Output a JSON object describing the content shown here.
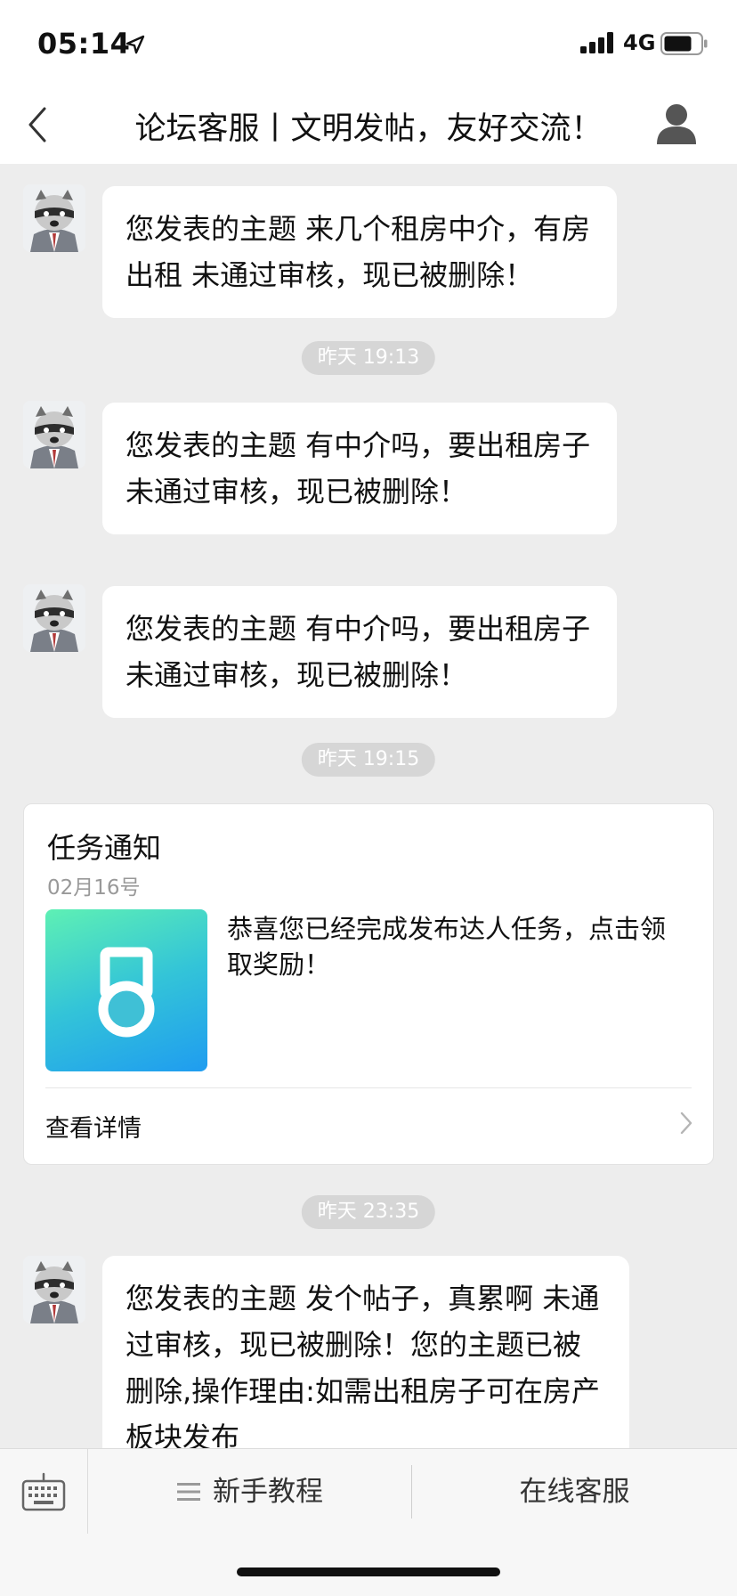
{
  "status_bar": {
    "time": "05:14",
    "network": "4G",
    "icons": [
      "location-arrow-icon",
      "signal-icon",
      "battery-icon"
    ]
  },
  "nav": {
    "title": "论坛客服丨文明发帖，友好交流！",
    "icons": [
      "back-icon",
      "user-icon"
    ]
  },
  "messages": [
    {
      "text": "您发表的主题 来几个租房中介，有房出租 未通过审核，现已被删除！"
    },
    {
      "timestamp": "昨天 19:13"
    },
    {
      "text": "您发表的主题 有中介吗，要出租房子 未通过审核，现已被删除！"
    },
    {
      "text": "您发表的主题 有中介吗，要出租房子 未通过审核，现已被删除！"
    },
    {
      "timestamp": "昨天 19:15"
    },
    {
      "timestamp": "昨天 23:35"
    },
    {
      "text": "您发表的主题 发个帖子，真累啊 未通过审核，现已被删除！您的主题已被删除,操作理由:如需出租房子可在房产板块发布"
    }
  ],
  "card": {
    "title": "任务通知",
    "date": "02月16号",
    "text": "恭喜您已经完成发布达人任务，点击领取奖励！",
    "link_label": "查看详情",
    "icon": "medal-icon"
  },
  "bottom_bar": {
    "guide_label": "新手教程",
    "service_label": "在线客服",
    "icons": [
      "keyboard-icon",
      "menu-icon"
    ]
  },
  "colors": {
    "background": "#ededed",
    "bubble": "#ffffff",
    "timestamp_bg": "#d6d6d6",
    "medal_gradient_top": "#5ef0b4",
    "medal_gradient_bottom": "#1f9cf0"
  }
}
